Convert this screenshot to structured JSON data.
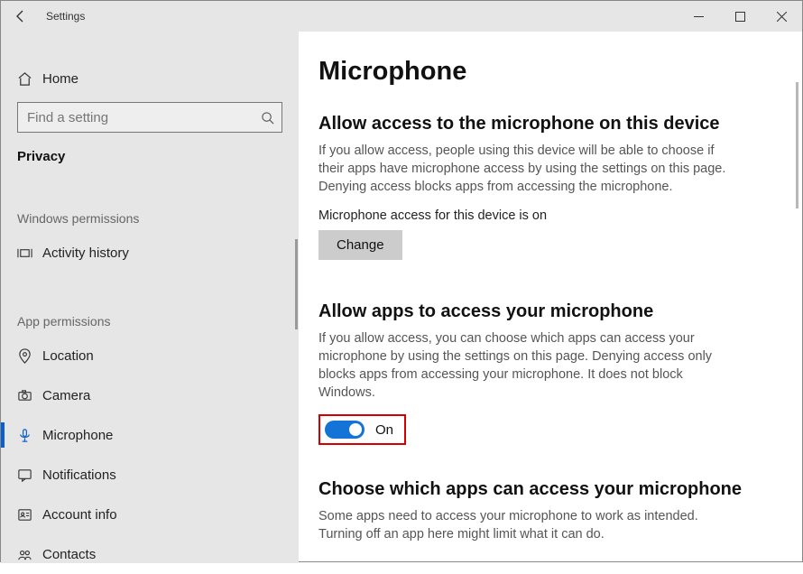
{
  "window": {
    "title": "Settings"
  },
  "sidebar": {
    "home": "Home",
    "search_placeholder": "Find a setting",
    "category": "Privacy",
    "groups": [
      {
        "header": "Windows permissions",
        "items": [
          {
            "label": "Activity history",
            "icon": "activity-history-icon",
            "selected": false
          }
        ]
      },
      {
        "header": "App permissions",
        "items": [
          {
            "label": "Location",
            "icon": "location-icon",
            "selected": false
          },
          {
            "label": "Camera",
            "icon": "camera-icon",
            "selected": false
          },
          {
            "label": "Microphone",
            "icon": "microphone-icon",
            "selected": true
          },
          {
            "label": "Notifications",
            "icon": "notifications-icon",
            "selected": false
          },
          {
            "label": "Account info",
            "icon": "account-info-icon",
            "selected": false
          },
          {
            "label": "Contacts",
            "icon": "contacts-icon",
            "selected": false
          }
        ]
      }
    ]
  },
  "main": {
    "title": "Microphone",
    "section1": {
      "heading": "Allow access to the microphone on this device",
      "desc": "If you allow access, people using this device will be able to choose if their apps have microphone access by using the settings on this page. Denying access blocks apps from accessing the microphone.",
      "status": "Microphone access for this device is on",
      "button": "Change"
    },
    "section2": {
      "heading": "Allow apps to access your microphone",
      "desc": "If you allow access, you can choose which apps can access your microphone by using the settings on this page. Denying access only blocks apps from accessing your microphone. It does not block Windows.",
      "toggle_state": "On"
    },
    "section3": {
      "heading": "Choose which apps can access your microphone",
      "desc": "Some apps need to access your microphone to work as intended. Turning off an app here might limit what it can do."
    }
  }
}
